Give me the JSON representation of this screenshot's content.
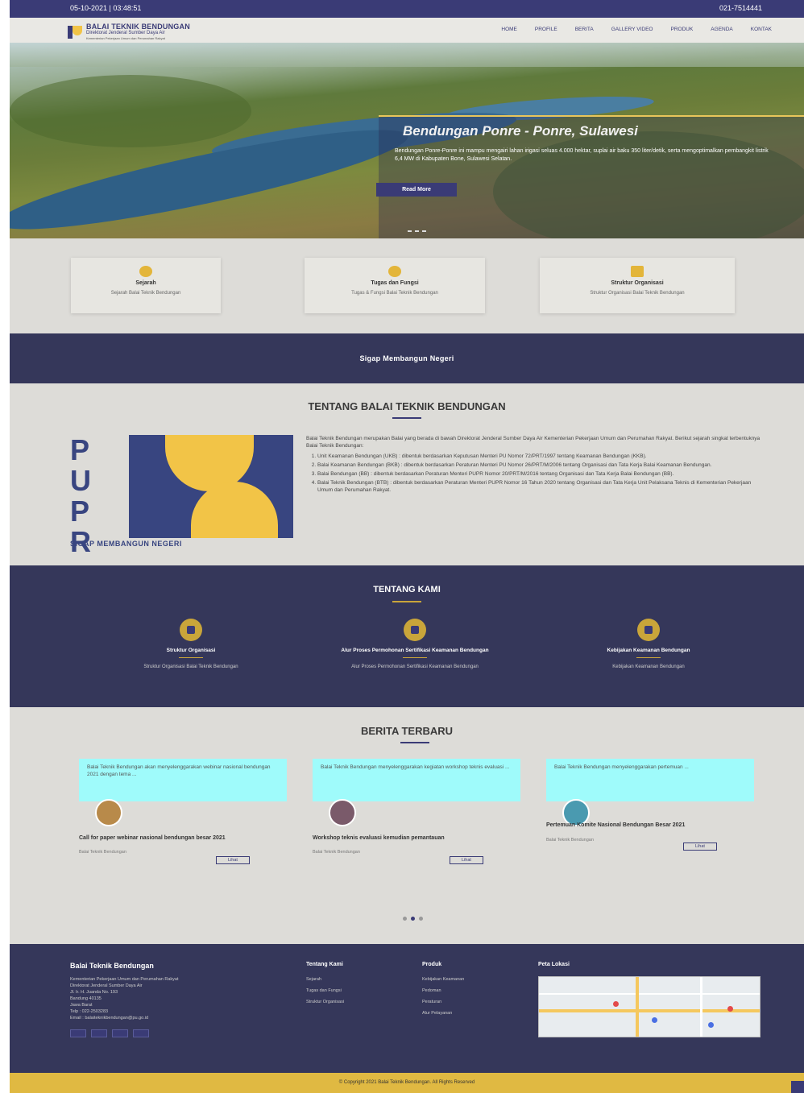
{
  "topbar": {
    "datetime": "05-10-2021 | 03:48:51",
    "phone": "021-7514441"
  },
  "header": {
    "logo_title": "BALAI TEKNIK BENDUNGAN",
    "logo_sub": "Direktorat Jenderal Sumber Daya Air",
    "logo_sub2": "Kementerian Pekerjaan Umum dan Perumahan Rakyat",
    "nav": [
      "HOME",
      "PROFILE",
      "BERITA",
      "GALLERY VIDEO",
      "PRODUK",
      "AGENDA",
      "KONTAK"
    ]
  },
  "hero": {
    "title": "Bendungan Ponre - Ponre, Sulawesi",
    "text": "Bendungan Ponre-Ponre ini mampu mengairi lahan irigasi seluas 4.000 hektar, suplai air baku 350 liter/detik, serta mengoptimalkan pembangkit listrik 6,4 MW di Kabupaten Bone, Sulawesi Selatan.",
    "button": "Read More"
  },
  "cards": [
    {
      "title": "Sejarah",
      "desc": "Sejarah Balai Teknik Bendungan"
    },
    {
      "title": "Tugas dan Fungsi",
      "desc": "Tugas & Fungsi Balai Teknik Bendungan"
    },
    {
      "title": "Struktur Organisasi",
      "desc": "Struktur Organisasi Balai Teknik Bendungan"
    }
  ],
  "band_text": "Sigap Membangun Negeri",
  "about": {
    "title": "TENTANG BALAI TEKNIK BENDUNGAN",
    "pupr_letters": [
      "P",
      "U",
      "P",
      "R"
    ],
    "slogan": "SIGAP MEMBANGUN NEGERI",
    "intro": "Balai Teknik Bendungan merupakan Balai yang berada di bawah Direktorat Jenderal Sumber Daya Air Kementerian Pekerjaan Umum dan Perumahan Rakyat. Berikut sejarah singkat terbentuknya Balai Teknik Bendungan:",
    "items": [
      "Unit Keamanan Bendungan (UKB) : dibentuk berdasarkan Keputusan Menteri PU Nomor 72/PRT/1997 tentang Keamanan Bendungan (KKB).",
      "Balai Keamanan Bendungan (BKB) : dibentuk berdasarkan Peraturan Menteri PU Nomor 26/PRT/M/2006 tentang Organisasi dan Tata Kerja Balai Keamanan Bendungan.",
      "Balai Bendungan (BB) : dibentuk berdasarkan Peraturan Menteri PUPR Nomor 20/PRT/M/2016 tentang Organisasi dan Tata Kerja Balai Bendungan (BB).",
      "Balai Teknik Bendungan (BTB) : dibentuk berdasarkan Peraturan Menteri PUPR Nomor 16 Tahun 2020 tentang Organisasi dan Tata Kerja Unit Pelaksana Teknis di Kementerian Pekerjaan Umum dan Perumahan Rakyat."
    ]
  },
  "kami": {
    "title": "TENTANG KAMI",
    "items": [
      {
        "name": "Struktur Organisasi",
        "desc": "Struktur Organisasi Balai Teknik Bendungan"
      },
      {
        "name": "Alur Proses Permohonan Sertifikasi Keamanan Bendungan",
        "desc": "Alur Proses Permohonan Sertifikasi Keamanan Bendungan"
      },
      {
        "name": "Kebijakan Keamanan Bendungan",
        "desc": "Kebijakan Keamanan Bendungan"
      }
    ]
  },
  "news": {
    "title": "BERITA TERBARU",
    "items": [
      {
        "quote": "Balai Teknik Bendungan akan menyelenggarakan webinar nasional bendungan 2021 dengan tema ...",
        "title": "Call for paper webinar nasional bendungan besar 2021",
        "meta": "Balai Teknik Bendungan",
        "btn": "Lihat"
      },
      {
        "quote": "Balai Teknik Bendungan menyelenggarakan kegiatan workshop teknis evaluasi ...",
        "title": "Workshop teknis evaluasi kemudian pemantauan",
        "meta": "Balai Teknik Bendungan",
        "btn": "Lihat"
      },
      {
        "quote": "Balai Teknik Bendungan menyelenggarakan pertemuan ...",
        "title": "Pertemuan Komite Nasional Bendungan Besar 2021",
        "meta": "Balai Teknik Bendungan",
        "btn": "Lihat"
      }
    ]
  },
  "footer": {
    "name": "Balai Teknik Bendungan",
    "address": [
      "Kementerian Pekerjaan Umum dan Perumahan Rakyat",
      "Direktorat Jenderal Sumber Daya Air",
      "Jl. Ir. H. Juanda No. 193",
      "Bandung 40135",
      "Jawa Barat",
      "Telp : 022-2503283",
      "Email : balaiteknikbendungan@pu.go.id"
    ],
    "col1_title": "Tentang Kami",
    "col1_links": [
      "Sejarah",
      "Tugas dan Fungsi",
      "Struktur Organisasi"
    ],
    "col2_title": "Produk",
    "col2_links": [
      "Kebijakan Keamanan",
      "Pedoman",
      "Peraturan",
      "Alur Pelayanan"
    ],
    "map_title": "Peta Lokasi"
  },
  "copyright": "© Copyright 2021 Balai Teknik Bendungan. All Rights Reserved"
}
